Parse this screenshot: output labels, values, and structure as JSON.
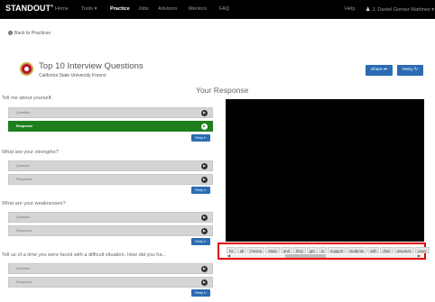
{
  "nav": {
    "logo": "STANDOUT",
    "logo_mark": "®",
    "items": [
      "Home",
      "Tools ▾",
      "Practice",
      "Jobs",
      "Advisors",
      "Mentors",
      "FAQ"
    ],
    "active_item": "Practice",
    "help": "Help",
    "user": "J. Daniel Gomez Martinez ▾"
  },
  "header": {
    "back_label": "Back to Practices",
    "title": "Top 10 Interview Questions",
    "subtitle": "California State University Fresno",
    "share_label": "Share ➦",
    "retry_label": "Retry ↻",
    "your_response": "Your Response"
  },
  "questions": [
    {
      "title": "Tell me about yourself.",
      "question_label": "Question",
      "response_label": "Response",
      "retry": "Retry ↻"
    },
    {
      "title": "What are your strengths?",
      "question_label": "Question",
      "response_label": "Response",
      "retry": "Retry ↻"
    },
    {
      "title": "What are your weaknesses?",
      "question_label": "Question",
      "response_label": "Response",
      "retry": "Retry ↻"
    },
    {
      "title": "Tell us of a time you were faced with a difficult situation. How did you ha...",
      "question_label": "Question",
      "response_label": "Response",
      "retry": "Retry ↻"
    }
  ],
  "captions": [
    "for",
    "all",
    "Fresno",
    "State",
    "and",
    "they",
    "get",
    "to",
    "support",
    "students",
    "with",
    "their",
    "resumes",
    "cover"
  ],
  "colors": {
    "nav_bg": "#000000",
    "accent_blue": "#2b6cb3",
    "response_green": "#1f7f1f",
    "highlight_red": "#e60000"
  },
  "icons": {
    "back": "circle-arrow-left-icon",
    "play": "play-icon",
    "share": "share-icon",
    "retry": "retry-icon",
    "user": "user-icon"
  }
}
